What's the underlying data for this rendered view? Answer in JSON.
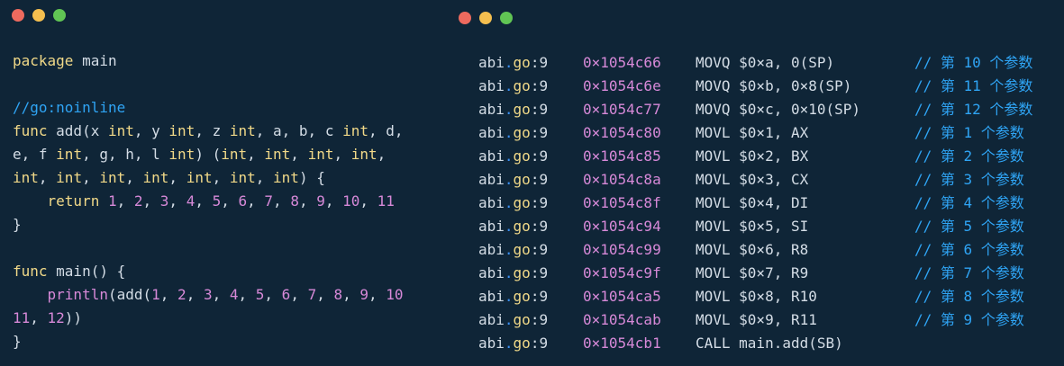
{
  "left_code": {
    "lines": [
      [
        {
          "t": "package",
          "c": "keyword"
        },
        {
          "t": " main",
          "c": "ident"
        }
      ],
      [],
      [
        {
          "t": "//go:noinline",
          "c": "comment"
        }
      ],
      [
        {
          "t": "func",
          "c": "keyword"
        },
        {
          "t": " add(x ",
          "c": "ident"
        },
        {
          "t": "int",
          "c": "type"
        },
        {
          "t": ", y ",
          "c": "ident"
        },
        {
          "t": "int",
          "c": "type"
        },
        {
          "t": ", z ",
          "c": "ident"
        },
        {
          "t": "int",
          "c": "type"
        },
        {
          "t": ", a, b, c ",
          "c": "ident"
        },
        {
          "t": "int",
          "c": "type"
        },
        {
          "t": ", d,",
          "c": "ident"
        }
      ],
      [
        {
          "t": "e, f ",
          "c": "ident"
        },
        {
          "t": "int",
          "c": "type"
        },
        {
          "t": ", g, h, l ",
          "c": "ident"
        },
        {
          "t": "int",
          "c": "type"
        },
        {
          "t": ") (",
          "c": "ident"
        },
        {
          "t": "int",
          "c": "type"
        },
        {
          "t": ", ",
          "c": "ident"
        },
        {
          "t": "int",
          "c": "type"
        },
        {
          "t": ", ",
          "c": "ident"
        },
        {
          "t": "int",
          "c": "type"
        },
        {
          "t": ", ",
          "c": "ident"
        },
        {
          "t": "int",
          "c": "type"
        },
        {
          "t": ",",
          "c": "ident"
        }
      ],
      [
        {
          "t": "int",
          "c": "type"
        },
        {
          "t": ", ",
          "c": "ident"
        },
        {
          "t": "int",
          "c": "type"
        },
        {
          "t": ", ",
          "c": "ident"
        },
        {
          "t": "int",
          "c": "type"
        },
        {
          "t": ", ",
          "c": "ident"
        },
        {
          "t": "int",
          "c": "type"
        },
        {
          "t": ", ",
          "c": "ident"
        },
        {
          "t": "int",
          "c": "type"
        },
        {
          "t": ", ",
          "c": "ident"
        },
        {
          "t": "int",
          "c": "type"
        },
        {
          "t": ", ",
          "c": "ident"
        },
        {
          "t": "int",
          "c": "type"
        },
        {
          "t": ") {",
          "c": "ident"
        }
      ],
      [
        {
          "t": "    ",
          "c": "ident"
        },
        {
          "t": "return",
          "c": "keyword"
        },
        {
          "t": " ",
          "c": "ident"
        },
        {
          "t": "1",
          "c": "number"
        },
        {
          "t": ", ",
          "c": "ident"
        },
        {
          "t": "2",
          "c": "number"
        },
        {
          "t": ", ",
          "c": "ident"
        },
        {
          "t": "3",
          "c": "number"
        },
        {
          "t": ", ",
          "c": "ident"
        },
        {
          "t": "4",
          "c": "number"
        },
        {
          "t": ", ",
          "c": "ident"
        },
        {
          "t": "5",
          "c": "number"
        },
        {
          "t": ", ",
          "c": "ident"
        },
        {
          "t": "6",
          "c": "number"
        },
        {
          "t": ", ",
          "c": "ident"
        },
        {
          "t": "7",
          "c": "number"
        },
        {
          "t": ", ",
          "c": "ident"
        },
        {
          "t": "8",
          "c": "number"
        },
        {
          "t": ", ",
          "c": "ident"
        },
        {
          "t": "9",
          "c": "number"
        },
        {
          "t": ", ",
          "c": "ident"
        },
        {
          "t": "10",
          "c": "number"
        },
        {
          "t": ", ",
          "c": "ident"
        },
        {
          "t": "11",
          "c": "number"
        }
      ],
      [
        {
          "t": "}",
          "c": "ident"
        }
      ],
      [],
      [
        {
          "t": "func",
          "c": "keyword"
        },
        {
          "t": " main() {",
          "c": "ident"
        }
      ],
      [
        {
          "t": "    ",
          "c": "ident"
        },
        {
          "t": "println",
          "c": "func"
        },
        {
          "t": "(add(",
          "c": "ident"
        },
        {
          "t": "1",
          "c": "number"
        },
        {
          "t": ", ",
          "c": "ident"
        },
        {
          "t": "2",
          "c": "number"
        },
        {
          "t": ", ",
          "c": "ident"
        },
        {
          "t": "3",
          "c": "number"
        },
        {
          "t": ", ",
          "c": "ident"
        },
        {
          "t": "4",
          "c": "number"
        },
        {
          "t": ", ",
          "c": "ident"
        },
        {
          "t": "5",
          "c": "number"
        },
        {
          "t": ", ",
          "c": "ident"
        },
        {
          "t": "6",
          "c": "number"
        },
        {
          "t": ", ",
          "c": "ident"
        },
        {
          "t": "7",
          "c": "number"
        },
        {
          "t": ", ",
          "c": "ident"
        },
        {
          "t": "8",
          "c": "number"
        },
        {
          "t": ", ",
          "c": "ident"
        },
        {
          "t": "9",
          "c": "number"
        },
        {
          "t": ", ",
          "c": "ident"
        },
        {
          "t": "10",
          "c": "number"
        }
      ],
      [
        {
          "t": "11",
          "c": "number"
        },
        {
          "t": ", ",
          "c": "ident"
        },
        {
          "t": "12",
          "c": "number"
        },
        {
          "t": "))",
          "c": "ident"
        }
      ],
      [
        {
          "t": "}",
          "c": "ident"
        }
      ]
    ]
  },
  "asm_rows": [
    {
      "file": "abi",
      "ext": "go",
      "line": "9",
      "addr": "0×1054c66",
      "op": "MOVQ $0×a, 0(SP)",
      "comment": "// 第 10 个参数"
    },
    {
      "file": "abi",
      "ext": "go",
      "line": "9",
      "addr": "0×1054c6e",
      "op": "MOVQ $0×b, 0×8(SP)",
      "comment": "// 第 11 个参数"
    },
    {
      "file": "abi",
      "ext": "go",
      "line": "9",
      "addr": "0×1054c77",
      "op": "MOVQ $0×c, 0×10(SP)",
      "comment": "// 第 12 个参数"
    },
    {
      "file": "abi",
      "ext": "go",
      "line": "9",
      "addr": "0×1054c80",
      "op": "MOVL $0×1, AX",
      "comment": "// 第 1 个参数"
    },
    {
      "file": "abi",
      "ext": "go",
      "line": "9",
      "addr": "0×1054c85",
      "op": "MOVL $0×2, BX",
      "comment": "// 第 2 个参数"
    },
    {
      "file": "abi",
      "ext": "go",
      "line": "9",
      "addr": "0×1054c8a",
      "op": "MOVL $0×3, CX",
      "comment": "// 第 3 个参数"
    },
    {
      "file": "abi",
      "ext": "go",
      "line": "9",
      "addr": "0×1054c8f",
      "op": "MOVL $0×4, DI",
      "comment": "// 第 4 个参数"
    },
    {
      "file": "abi",
      "ext": "go",
      "line": "9",
      "addr": "0×1054c94",
      "op": "MOVL $0×5, SI",
      "comment": "// 第 5 个参数"
    },
    {
      "file": "abi",
      "ext": "go",
      "line": "9",
      "addr": "0×1054c99",
      "op": "MOVL $0×6, R8",
      "comment": "// 第 6 个参数"
    },
    {
      "file": "abi",
      "ext": "go",
      "line": "9",
      "addr": "0×1054c9f",
      "op": "MOVL $0×7, R9",
      "comment": "// 第 7 个参数"
    },
    {
      "file": "abi",
      "ext": "go",
      "line": "9",
      "addr": "0×1054ca5",
      "op": "MOVL $0×8, R10",
      "comment": "// 第 8 个参数"
    },
    {
      "file": "abi",
      "ext": "go",
      "line": "9",
      "addr": "0×1054cab",
      "op": "MOVL $0×9, R11",
      "comment": "// 第 9 个参数"
    },
    {
      "file": "abi",
      "ext": "go",
      "line": "9",
      "addr": "0×1054cb1",
      "op": "CALL main.add(SB)",
      "comment": ""
    }
  ],
  "colors": {
    "background": "#0f2537",
    "keyword": "#f1d988",
    "number": "#d789d8",
    "comment": "#2fa4f4",
    "text": "#d4dde6",
    "traffic_red": "#ed6a5e",
    "traffic_yellow": "#f5bf4f",
    "traffic_green": "#61c554"
  }
}
